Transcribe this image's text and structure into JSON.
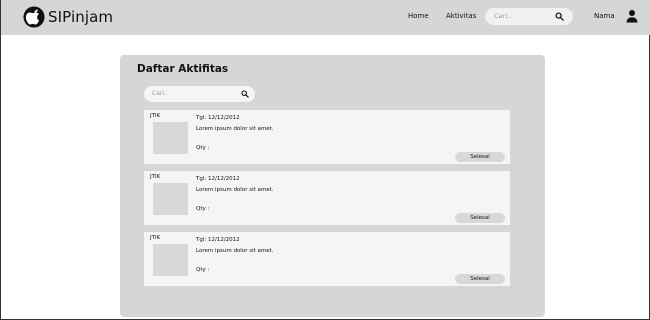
{
  "navbar": {
    "brand": "SIPinjam",
    "brand_logo_icon": "apple-icon",
    "links": [
      "Home",
      "Aktivitas"
    ],
    "search": {
      "placeholder": "Cari.."
    },
    "user_name": "Nama",
    "user_icon": "user-icon"
  },
  "panel": {
    "title": "Daftar Aktifitas",
    "search": {
      "placeholder": "Cari.."
    },
    "items": [
      {
        "code": "JTIK",
        "date": "Tgl: 12/12/2012",
        "description": "Lorem ipsum dolor sit amet.",
        "qty": "Qty :",
        "button": "Selesai"
      },
      {
        "code": "JTIK",
        "date": "Tgl: 12/12/2012",
        "description": "Lorem ipsum dolor sit amet.",
        "qty": "Qty :",
        "button": "Selesai"
      },
      {
        "code": "JTIK",
        "date": "Tgl: 12/12/2012",
        "description": "Lorem ipsum dolor sit amet.",
        "qty": "Qty :",
        "button": "Selesai"
      }
    ]
  },
  "colors": {
    "navbar_bg": "#d6d6d6",
    "panel_bg": "#d6d6d6",
    "card_bg": "#f5f5f5",
    "thumb_bg": "#d8d8d8",
    "text": "#111111"
  }
}
